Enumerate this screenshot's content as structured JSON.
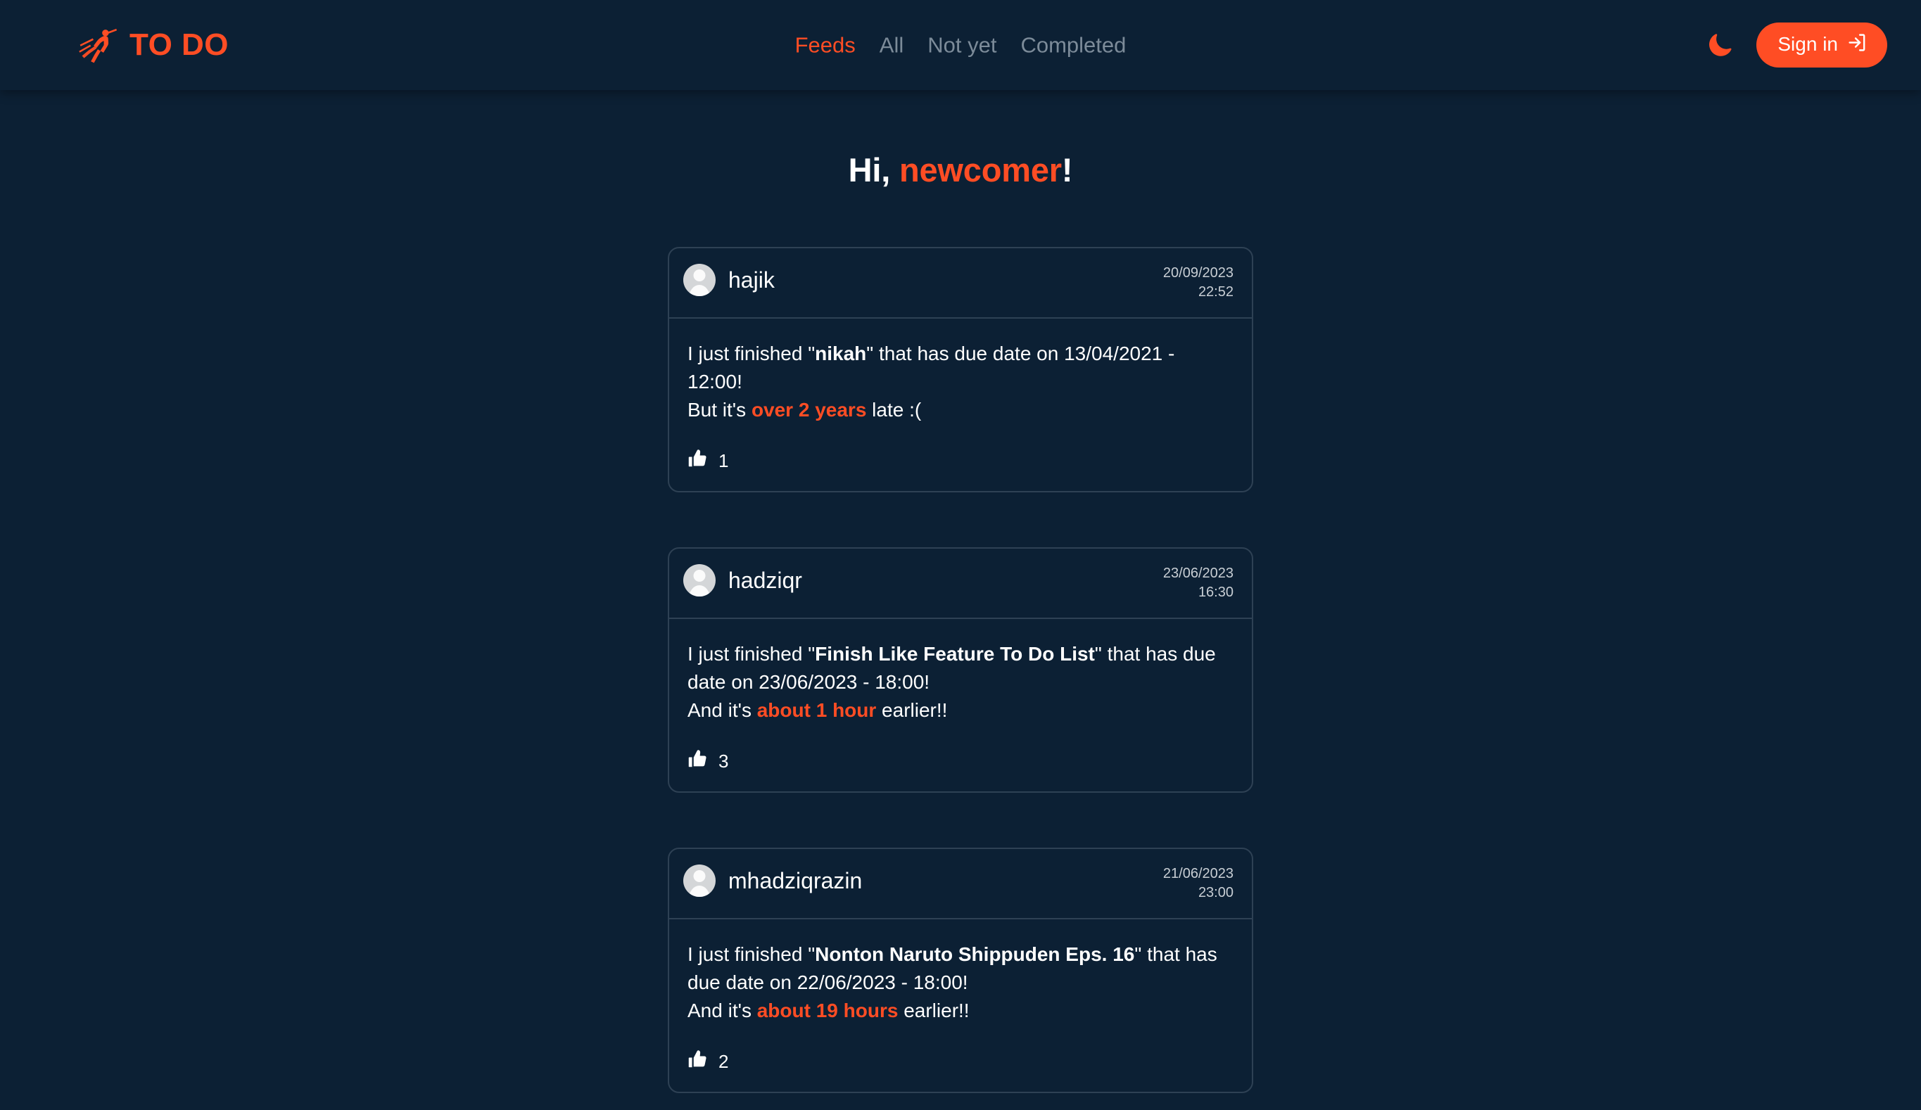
{
  "header": {
    "brand": {
      "icon": "running-man-icon",
      "text": "TO DO"
    },
    "nav": [
      {
        "label": "Feeds",
        "active": true
      },
      {
        "label": "All",
        "active": false
      },
      {
        "label": "Not yet",
        "active": false
      },
      {
        "label": "Completed",
        "active": false
      }
    ],
    "theme_toggle": {
      "icon": "moon-icon"
    },
    "signin": {
      "label": "Sign in",
      "icon": "login-arrow-icon"
    }
  },
  "main": {
    "greeting": {
      "prefix": "Hi, ",
      "name": "newcomer",
      "suffix": "!"
    },
    "feeds": [
      {
        "author": "hajik",
        "date": "20/09/2023",
        "time": "22:52",
        "text_parts": [
          {
            "text": "I just finished \"",
            "style": "normal"
          },
          {
            "text": "nikah",
            "style": "bold"
          },
          {
            "text": "\" that has due date on 13/04/2021 - 12:00!",
            "style": "normal"
          },
          {
            "text": "\n",
            "style": "break"
          },
          {
            "text": "But it's ",
            "style": "normal"
          },
          {
            "text": "over 2 years",
            "style": "accent"
          },
          {
            "text": " late :(",
            "style": "normal"
          }
        ],
        "task_title": "nikah",
        "due": "13/04/2021 - 12:00",
        "delta": "over 2 years",
        "delta_suffix": " late :(",
        "likes": "1"
      },
      {
        "author": "hadziqr",
        "date": "23/06/2023",
        "time": "16:30",
        "text_parts": [
          {
            "text": "I just finished \"",
            "style": "normal"
          },
          {
            "text": "Finish Like Feature To Do List",
            "style": "bold"
          },
          {
            "text": "\" that has due date on 23/06/2023 - 18:00!",
            "style": "normal"
          },
          {
            "text": "\n",
            "style": "break"
          },
          {
            "text": "And it's ",
            "style": "normal"
          },
          {
            "text": "about 1 hour",
            "style": "accent"
          },
          {
            "text": " earlier!!",
            "style": "normal"
          }
        ],
        "task_title": "Finish Like Feature To Do List",
        "due": "23/06/2023 - 18:00",
        "delta": "about 1 hour",
        "delta_suffix": " earlier!!",
        "likes": "3"
      },
      {
        "author": "mhadziqrazin",
        "date": "21/06/2023",
        "time": "23:00",
        "text_parts": [
          {
            "text": "I just finished \"",
            "style": "normal"
          },
          {
            "text": "Nonton Naruto Shippuden Eps. 16",
            "style": "bold"
          },
          {
            "text": "\" that has due date on 22/06/2023 - 18:00!",
            "style": "normal"
          },
          {
            "text": "\n",
            "style": "break"
          },
          {
            "text": "And it's ",
            "style": "normal"
          },
          {
            "text": "about 19 hours",
            "style": "accent"
          },
          {
            "text": " earlier!!",
            "style": "normal"
          }
        ],
        "task_title": "Nonton Naruto Shippuden Eps. 16",
        "due": "22/06/2023 - 18:00",
        "delta": "about 19 hours",
        "delta_suffix": " earlier!!",
        "likes": "2"
      }
    ]
  },
  "colors": {
    "accent": "#ff4d24",
    "background": "#0c2034",
    "card_border": "#2e4154",
    "nav_inactive": "#7c8b99",
    "timestamp": "#c8ced4",
    "avatar_bg": "#d4d6d8"
  },
  "strings": {
    "finished_prefix": "I just finished \"",
    "due_prefix": "\" that has due date on ",
    "due_suffix": "!",
    "like_icon": "thumbs-up-icon"
  }
}
